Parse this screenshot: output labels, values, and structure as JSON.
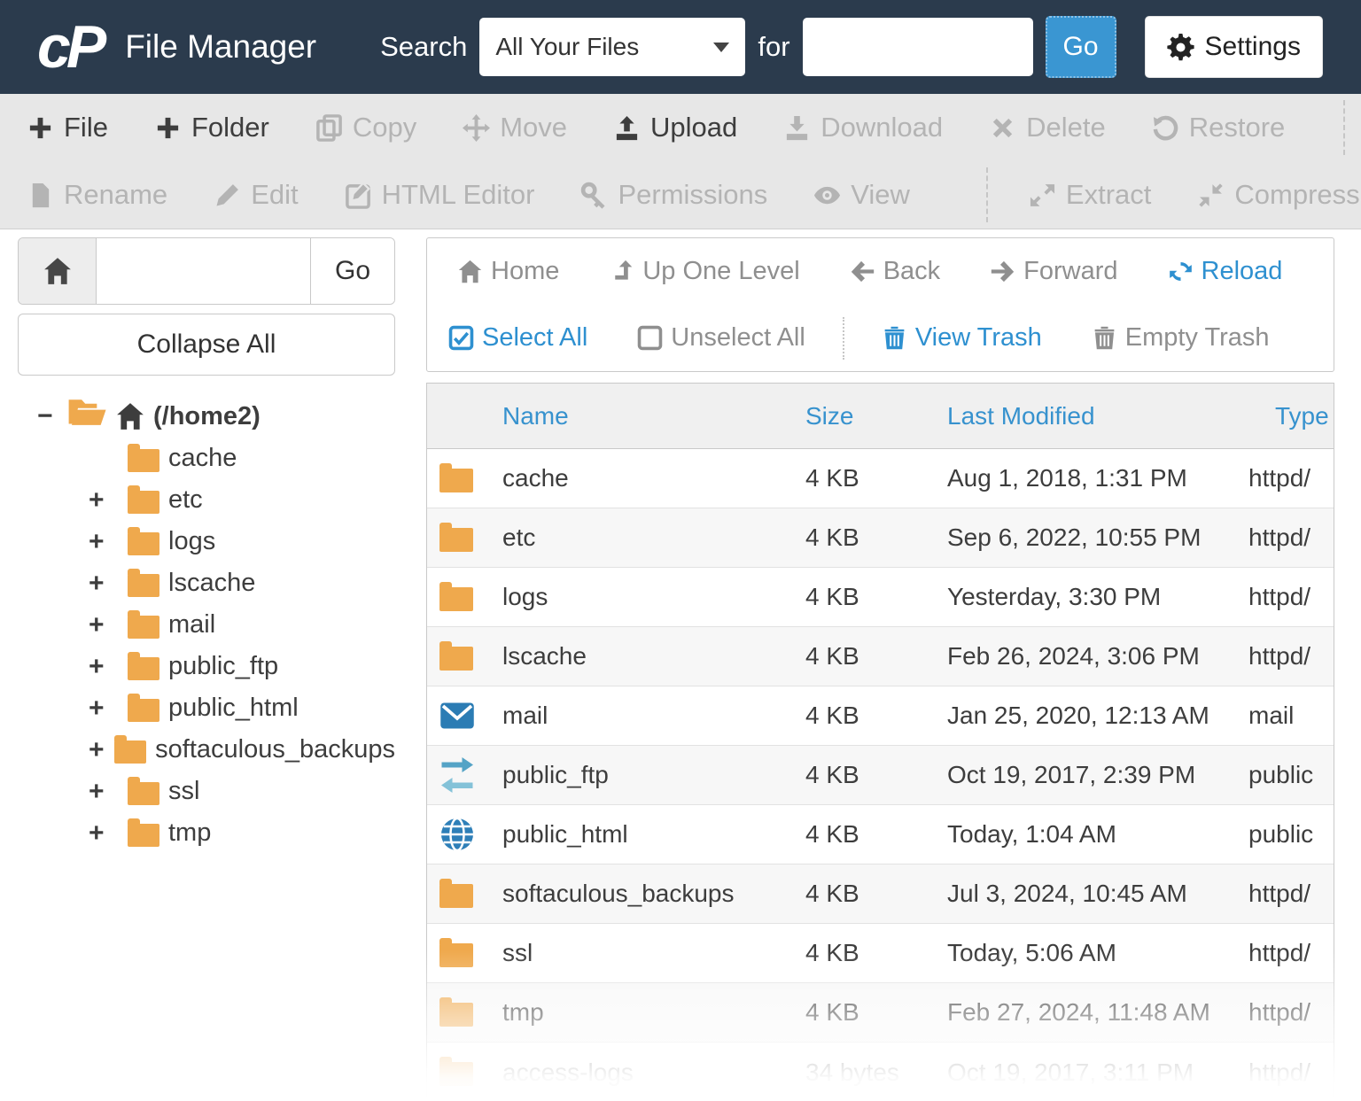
{
  "header": {
    "logo": "cP",
    "title": "File Manager",
    "search_label": "Search",
    "search_scope": "All Your Files",
    "for_label": "for",
    "search_value": "",
    "go": "Go",
    "settings": "Settings"
  },
  "toolbar": {
    "row1": [
      {
        "label": "File"
      },
      {
        "label": "Folder"
      },
      {
        "label": "Copy"
      },
      {
        "label": "Move"
      },
      {
        "label": "Upload"
      },
      {
        "label": "Download"
      },
      {
        "label": "Delete"
      },
      {
        "label": "Restore"
      }
    ],
    "row2": [
      {
        "label": "Rename"
      },
      {
        "label": "Edit"
      },
      {
        "label": "HTML Editor"
      },
      {
        "label": "Permissions"
      },
      {
        "label": "View"
      },
      {
        "label": "Extract"
      },
      {
        "label": "Compress"
      }
    ]
  },
  "sidebar": {
    "path_value": "",
    "path_go": "Go",
    "collapse_all": "Collapse All",
    "tree": {
      "root": {
        "toggle": "−",
        "label": "(/home2)"
      },
      "items": [
        {
          "toggle": "",
          "label": "cache"
        },
        {
          "toggle": "+",
          "label": "etc"
        },
        {
          "toggle": "+",
          "label": "logs"
        },
        {
          "toggle": "+",
          "label": "lscache"
        },
        {
          "toggle": "+",
          "label": "mail"
        },
        {
          "toggle": "+",
          "label": "public_ftp"
        },
        {
          "toggle": "+",
          "label": "public_html"
        },
        {
          "toggle": "+",
          "label": "softaculous_backups"
        },
        {
          "toggle": "+",
          "label": "ssl"
        },
        {
          "toggle": "+",
          "label": "tmp"
        }
      ]
    }
  },
  "navbar": {
    "home": "Home",
    "up_one_level": "Up One Level",
    "back": "Back",
    "forward": "Forward",
    "reload": "Reload",
    "select_all": "Select All",
    "unselect_all": "Unselect All",
    "view_trash": "View Trash",
    "empty_trash": "Empty Trash"
  },
  "table": {
    "headers": {
      "name": "Name",
      "size": "Size",
      "modified": "Last Modified",
      "type": "Type"
    },
    "rows": [
      {
        "name": "cache",
        "size": "4 KB",
        "modified": "Aug 1, 2018, 1:31 PM",
        "type": "httpd/"
      },
      {
        "name": "etc",
        "size": "4 KB",
        "modified": "Sep 6, 2022, 10:55 PM",
        "type": "httpd/"
      },
      {
        "name": "logs",
        "size": "4 KB",
        "modified": "Yesterday, 3:30 PM",
        "type": "httpd/"
      },
      {
        "name": "lscache",
        "size": "4 KB",
        "modified": "Feb 26, 2024, 3:06 PM",
        "type": "httpd/"
      },
      {
        "name": "mail",
        "size": "4 KB",
        "modified": "Jan 25, 2020, 12:13 AM",
        "type": "mail"
      },
      {
        "name": "public_ftp",
        "size": "4 KB",
        "modified": "Oct 19, 2017, 2:39 PM",
        "type": "public"
      },
      {
        "name": "public_html",
        "size": "4 KB",
        "modified": "Today, 1:04 AM",
        "type": "public"
      },
      {
        "name": "softaculous_backups",
        "size": "4 KB",
        "modified": "Jul 3, 2024, 10:45 AM",
        "type": "httpd/"
      },
      {
        "name": "ssl",
        "size": "4 KB",
        "modified": "Today, 5:06 AM",
        "type": "httpd/"
      },
      {
        "name": "tmp",
        "size": "4 KB",
        "modified": "Feb 27, 2024, 11:48 AM",
        "type": "httpd/"
      },
      {
        "name": "access-logs",
        "size": "34 bytes",
        "modified": "Oct 19, 2017, 3:11 PM",
        "type": "httpd/"
      }
    ]
  },
  "colors": {
    "header_bg": "#2b3b4d",
    "accent_blue": "#2e90d0",
    "button_blue": "#3a96d2",
    "folder_orange": "#efa94d",
    "disabled_gray": "#b4b4b4"
  }
}
